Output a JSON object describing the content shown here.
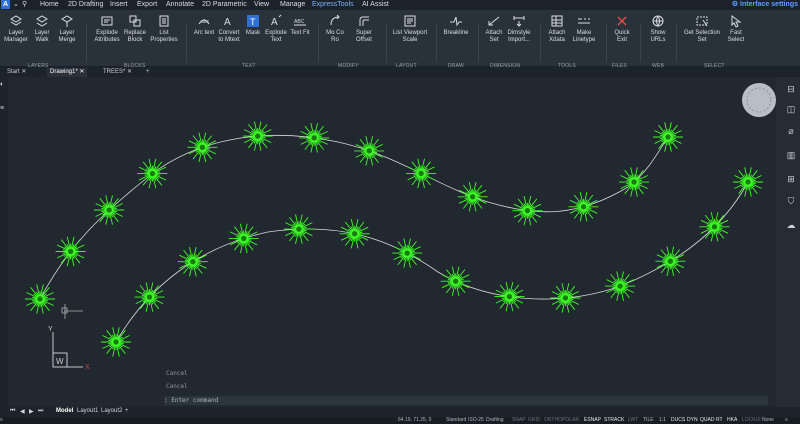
{
  "menu": {
    "logo": "A",
    "items": [
      "Home",
      "2D Drafting",
      "Insert",
      "Export",
      "Annotate",
      "2D Parametric",
      "View",
      "Manage",
      "ExpressTools",
      "AI Assist"
    ],
    "active": "ExpressTools",
    "settings": "Interface settings"
  },
  "ribbon": {
    "tools": [
      {
        "l1": "Layer",
        "l2": "Manager"
      },
      {
        "l1": "Layer",
        "l2": "Walk"
      },
      {
        "l1": "Layer",
        "l2": "Merge"
      },
      {
        "l1": "Explode",
        "l2": "Attributes"
      },
      {
        "l1": "Replace",
        "l2": "Block"
      },
      {
        "l1": "List",
        "l2": "Properties"
      },
      {
        "l1": "Arc text",
        "l2": ""
      },
      {
        "l1": "Convert",
        "l2": "to Mtext"
      },
      {
        "l1": "Mask",
        "l2": ""
      },
      {
        "l1": "Explode",
        "l2": "Text"
      },
      {
        "l1": "Text Fit",
        "l2": ""
      },
      {
        "l1": "Mo Co",
        "l2": "Ro"
      },
      {
        "l1": "Super",
        "l2": "Offset"
      },
      {
        "l1": "List Viewport",
        "l2": "Scale"
      },
      {
        "l1": "Breakline",
        "l2": ""
      },
      {
        "l1": "Attach",
        "l2": "Set"
      },
      {
        "l1": "Dimstyle",
        "l2": "Import..."
      },
      {
        "l1": "Attach",
        "l2": "Xdata"
      },
      {
        "l1": "Make",
        "l2": "Linetype"
      },
      {
        "l1": "Quick",
        "l2": "Exit"
      },
      {
        "l1": "Show",
        "l2": "URLs"
      },
      {
        "l1": "Get Selection",
        "l2": "Set"
      },
      {
        "l1": "Fast",
        "l2": "Select"
      }
    ],
    "groups": [
      "LAYERS",
      "BLOCKS",
      "TEXT",
      "MODIFY",
      "LAYOUT",
      "DRAW",
      "DIMENSION",
      "TOOLS",
      "FILES",
      "WEB",
      "SELECT"
    ]
  },
  "tabs": [
    "Start",
    "Drawing1*",
    "TREES*"
  ],
  "active_tab": "Drawing1*",
  "command": {
    "history": [
      "Cancel",
      "Cancel"
    ],
    "placeholder": ": Enter command"
  },
  "layout_tabs": [
    "Model",
    "Layout1",
    "Layout2"
  ],
  "status": {
    "coords": "64.19, 71.25, 0",
    "items": [
      "Standard",
      "ISO-25",
      "Drafting",
      "SNAP",
      "GRID",
      "ORTHO",
      "POLAR",
      "ESNAP",
      "STRACK",
      "LWT",
      "TILE",
      "1:1",
      "DUCS",
      "DYN",
      "QUAD",
      "RT",
      "HKA",
      "LOCKUI",
      "None"
    ]
  },
  "ucs": {
    "x": "X",
    "y": "Y",
    "w": "W"
  },
  "colors": {
    "accent": "#5aa0ff",
    "tree": "#3cff22",
    "canvas": "#212830"
  }
}
